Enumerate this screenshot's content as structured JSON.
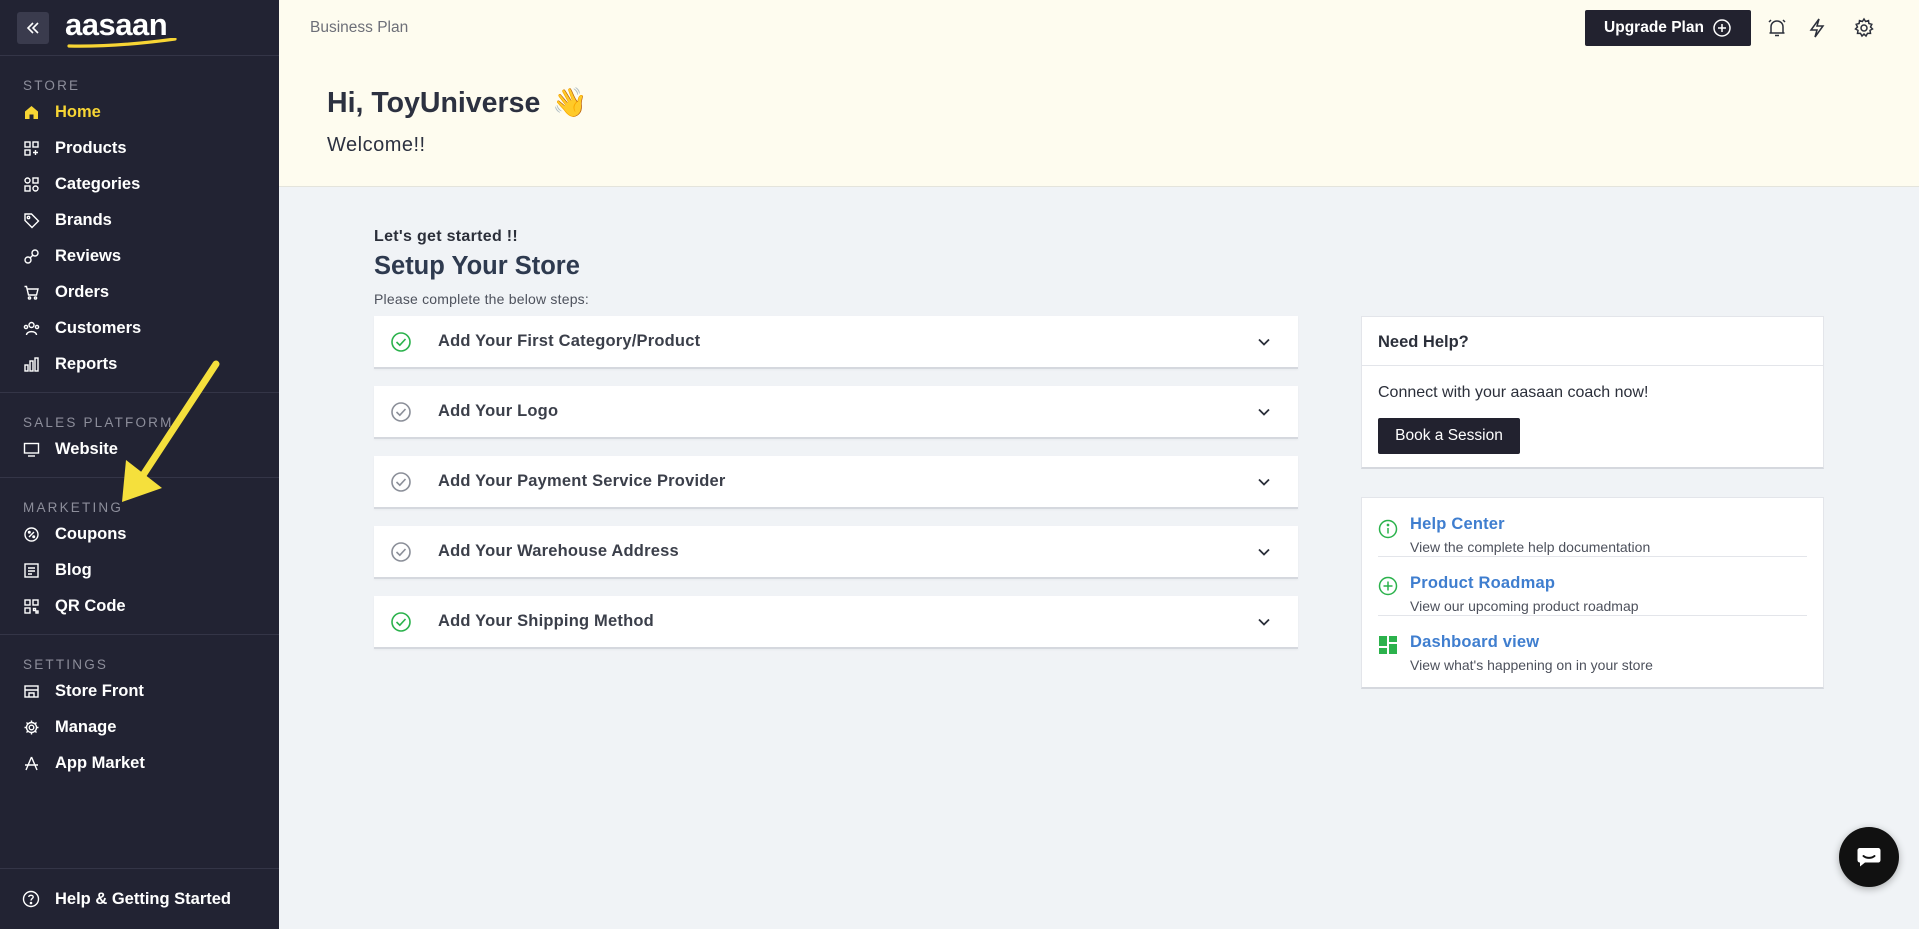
{
  "brand": {
    "logo_text": "aasaan"
  },
  "sidebar": {
    "sections": [
      {
        "heading": "STORE",
        "items": [
          {
            "label": "Home",
            "icon": "home-icon",
            "active": true
          },
          {
            "label": "Products",
            "icon": "products-icon"
          },
          {
            "label": "Categories",
            "icon": "categories-icon"
          },
          {
            "label": "Brands",
            "icon": "tag-icon"
          },
          {
            "label": "Reviews",
            "icon": "reviews-icon"
          },
          {
            "label": "Orders",
            "icon": "cart-icon"
          },
          {
            "label": "Customers",
            "icon": "users-icon"
          },
          {
            "label": "Reports",
            "icon": "bar-chart-icon"
          }
        ]
      },
      {
        "heading": "SALES PLATFORM",
        "items": [
          {
            "label": "Website",
            "icon": "monitor-icon"
          }
        ]
      },
      {
        "heading": "MARKETING",
        "items": [
          {
            "label": "Coupons",
            "icon": "coupon-icon"
          },
          {
            "label": "Blog",
            "icon": "blog-icon"
          },
          {
            "label": "QR Code",
            "icon": "qr-code-icon"
          }
        ]
      },
      {
        "heading": "SETTINGS",
        "items": [
          {
            "label": "Store Front",
            "icon": "storefront-icon"
          },
          {
            "label": "Manage",
            "icon": "gear-icon"
          },
          {
            "label": "App Market",
            "icon": "app-market-icon"
          }
        ]
      }
    ],
    "footer": {
      "label": "Help & Getting Started",
      "icon": "question-icon"
    }
  },
  "header": {
    "plan": "Business Plan",
    "upgrade_label": "Upgrade Plan",
    "greeting": "Hi, ToyUniverse",
    "greeting_emoji": "👋",
    "welcome": "Welcome!!"
  },
  "setup": {
    "kicker": "Let's get started !!",
    "title": "Setup Your Store",
    "subtitle": "Please complete the below steps:",
    "steps": [
      {
        "label": "Add Your First Category/Product",
        "done": true
      },
      {
        "label": "Add Your Logo",
        "done": false
      },
      {
        "label": "Add Your Payment Service Provider",
        "done": false
      },
      {
        "label": "Add Your Warehouse Address",
        "done": false
      },
      {
        "label": "Add Your Shipping Method",
        "done": true
      }
    ]
  },
  "help": {
    "title": "Need Help?",
    "text": "Connect with your aasaan coach now!",
    "button": "Book a Session"
  },
  "links": [
    {
      "title": "Help Center",
      "desc": "View the complete help documentation",
      "icon": "info-icon"
    },
    {
      "title": "Product Roadmap",
      "desc": "View our upcoming product roadmap",
      "icon": "plus-circle-icon"
    },
    {
      "title": "Dashboard view",
      "desc": "View what's happening on in your store",
      "icon": "dashboard-icon"
    }
  ],
  "colors": {
    "sidebar_bg": "#222333",
    "active": "#f7d534",
    "header_bg": "#fefcef",
    "link": "#3f7ecf",
    "check_done": "#2bb24c",
    "check_pending": "#8b8f99"
  }
}
